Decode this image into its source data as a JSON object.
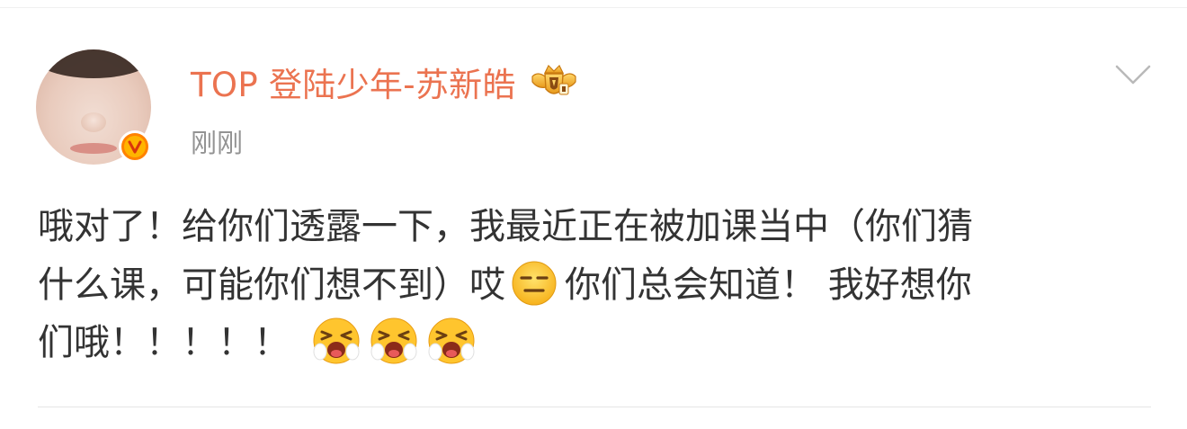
{
  "post": {
    "author": {
      "name": "TOP 登陆少年-苏新皓",
      "verified": true,
      "badge_icon": "crown-badge-icon",
      "name_color": "#eb7350"
    },
    "timestamp": "刚刚",
    "menu_icon": "chevron-down-icon",
    "text": {
      "line1": "哦对了！给你们透露一下，我最近正在被加课当中（你们猜",
      "line2_part1": "什么课，可能你们想不到）哎",
      "line2_emoji": "neutral-face-emoji",
      "line2_part2": "你们总会知道！ 我好想你",
      "line3": "们哦！！！！！",
      "line3_emojis": [
        "crying-face-emoji",
        "crying-face-emoji",
        "crying-face-emoji"
      ]
    }
  },
  "colors": {
    "accent": "#eb7350",
    "timestamp": "#939393",
    "body_text": "#333333",
    "verified_orange": "#ff8200"
  }
}
